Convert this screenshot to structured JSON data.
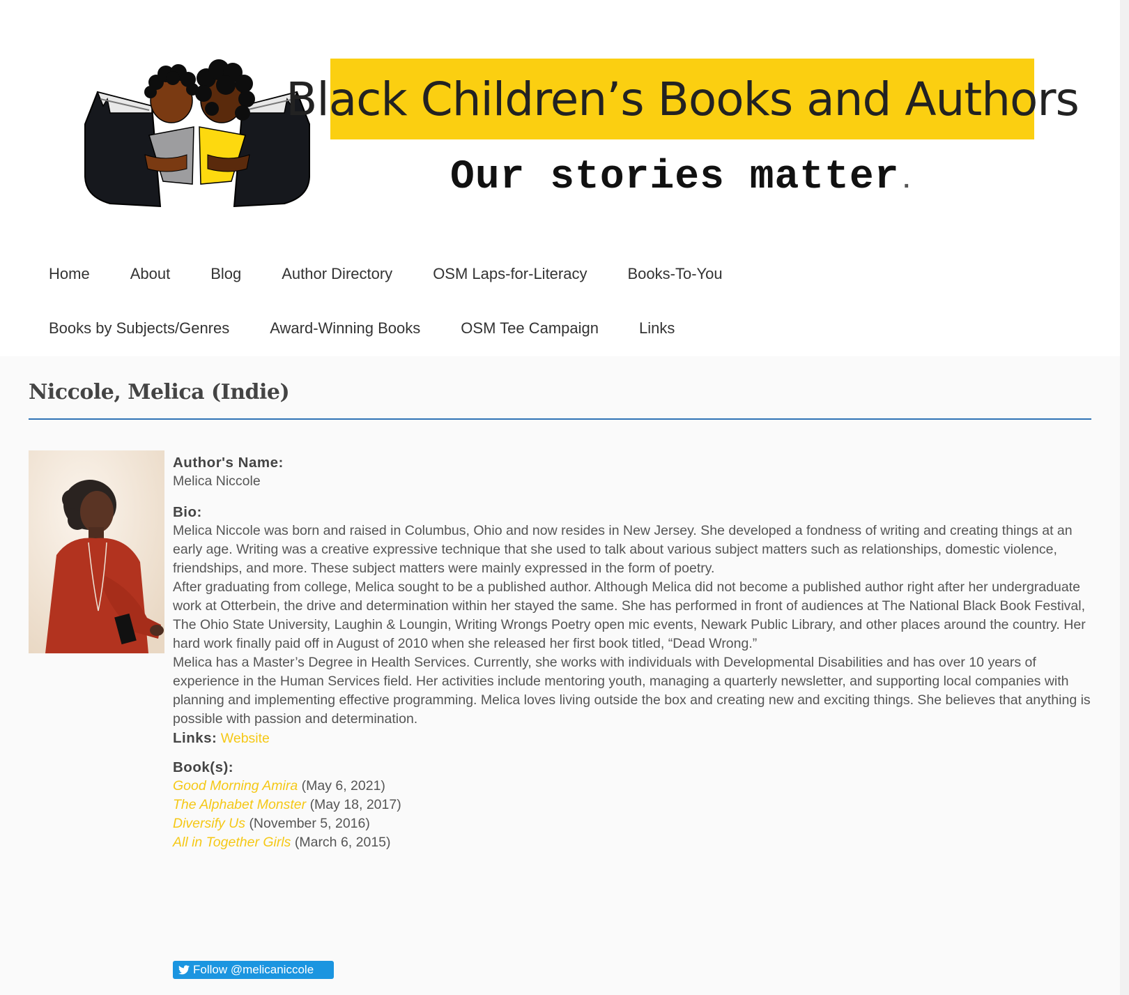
{
  "header": {
    "banner_title": "Black Children’s Books and Authors",
    "tagline": "Our stories matter",
    "tagline_dot": "."
  },
  "nav": {
    "row1": [
      "Home",
      "About",
      "Blog",
      "Author Directory",
      "OSM Laps-for-Literacy",
      "Books-To-You"
    ],
    "row2": [
      "Books by Subjects/Genres",
      "Award-Winning Books",
      "OSM Tee Campaign",
      "Links"
    ]
  },
  "page": {
    "title": "Niccole, Melica (Indie)"
  },
  "author": {
    "name_label": "Author's Name:",
    "name": "Melica Niccole",
    "bio_label": "Bio:",
    "bio": [
      "Melica Niccole was born and raised in Columbus, Ohio and now resides in New Jersey. She developed a fondness of writing and creating things at an early age. Writing was a creative expressive technique that she used to talk about various subject matters such as relationships, domestic violence, friendships, and more. These subject matters were mainly expressed in the form of poetry.",
      "After graduating from college, Melica sought to be a published author. Although Melica did not become a published author right after her undergraduate work at Otterbein, the drive and determination within her stayed the same. She has performed in front of audiences at The National Black Book Festival, The Ohio State University, Laughin & Loungin, Writing Wrongs Poetry open mic events, Newark Public Library, and other places around the country. Her hard work finally paid off in August of 2010 when she released her first book titled, “Dead Wrong.”",
      "Melica has a Master’s Degree in Health Services. Currently, she works with individuals with Developmental Disabilities and has over 10 years of experience in the Human Services field. Her activities include mentoring youth, managing a quarterly newsletter, and supporting local companies with planning and implementing effective programming. Melica loves living outside the box and creating new and exciting things. She believes that anything is possible with passion and determination."
    ],
    "links_label": "Links:",
    "website_link": "Website",
    "books_label": "Book(s):",
    "books": [
      {
        "title": "Good Morning Amira",
        "date": "(May 6, 2021)"
      },
      {
        "title": "The Alphabet Monster",
        "date": "(May 18, 2017)"
      },
      {
        "title": "Diversify Us",
        "date": "(November 5, 2016)"
      },
      {
        "title": "All in Together Girls",
        "date": "(March 6, 2015)"
      }
    ],
    "follow_button": "Follow @melicaniccole"
  },
  "colors": {
    "accent_yellow": "#fbcf11",
    "link_yellow": "#f5c816",
    "rule_blue": "#2f73b5",
    "twitter_blue": "#1b95e0"
  }
}
